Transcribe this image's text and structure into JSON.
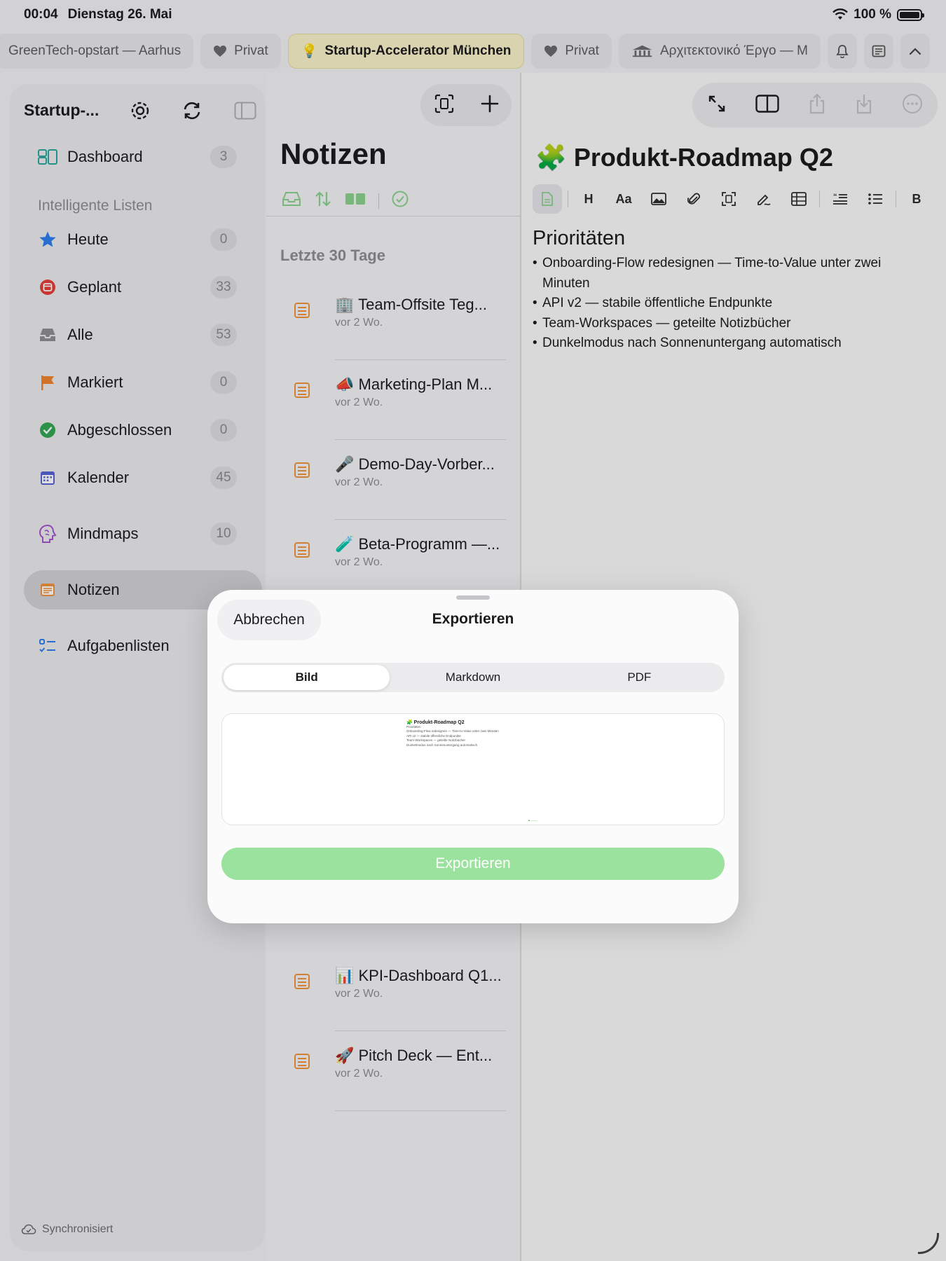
{
  "status": {
    "time": "00:04",
    "date": "Dienstag 26. Mai",
    "battery": "100 %"
  },
  "tabs": [
    {
      "label": "GreenTech-opstart — Aarhus"
    },
    {
      "label": "Privat"
    },
    {
      "label": "Startup-Accelerator München",
      "active": true
    },
    {
      "label": "Privat"
    },
    {
      "label": "Αρχιτεκτονικό Έργο — Μ"
    }
  ],
  "sidebar": {
    "title": "Startup-...",
    "dashboard": {
      "label": "Dashboard",
      "count": "3"
    },
    "section": "Intelligente Listen",
    "items": [
      {
        "label": "Heute",
        "count": "0"
      },
      {
        "label": "Geplant",
        "count": "33"
      },
      {
        "label": "Alle",
        "count": "53"
      },
      {
        "label": "Markiert",
        "count": "0"
      },
      {
        "label": "Abgeschlossen",
        "count": "0"
      },
      {
        "label": "Kalender",
        "count": "45"
      }
    ],
    "mindmaps": {
      "label": "Mindmaps",
      "count": "10"
    },
    "notizen": {
      "label": "Notizen"
    },
    "aufgaben": {
      "label": "Aufgabenlisten"
    },
    "footer": "Synchronisiert"
  },
  "notes": {
    "title": "Notizen",
    "section": "Letzte 30 Tage",
    "items": [
      {
        "title": "🏢 Team-Offsite Teg...",
        "sub": "vor 2 Wo."
      },
      {
        "title": "📣 Marketing-Plan M...",
        "sub": "vor 2 Wo."
      },
      {
        "title": "🎤 Demo-Day-Vorber...",
        "sub": "vor 2 Wo."
      },
      {
        "title": "🧪 Beta-Programm —...",
        "sub": "vor 2 Wo."
      },
      {
        "title": "📊 KPI-Dashboard Q1...",
        "sub": "vor 2 Wo."
      },
      {
        "title": "🚀 Pitch Deck — Ent...",
        "sub": "vor 2 Wo."
      }
    ]
  },
  "editor": {
    "emoji": "🧩",
    "title": "Produkt-Roadmap Q2",
    "heading": "Prioritäten",
    "bullets": [
      "Onboarding-Flow redesignen — Time-to-Value unter zwei Minuten",
      "API v2 — stabile öffentliche Endpunkte",
      "Team-Workspaces — geteilte Notizbücher",
      "Dunkelmodus nach Sonnenuntergang automatisch"
    ],
    "format": {
      "heading": "H",
      "text_style": "Aa",
      "bold": "B"
    }
  },
  "modal": {
    "cancel": "Abbrechen",
    "title": "Exportieren",
    "segments": [
      "Bild",
      "Markdown",
      "PDF"
    ],
    "selected": "Bild",
    "export_button": "Exportieren",
    "accent": "#9be29e"
  }
}
